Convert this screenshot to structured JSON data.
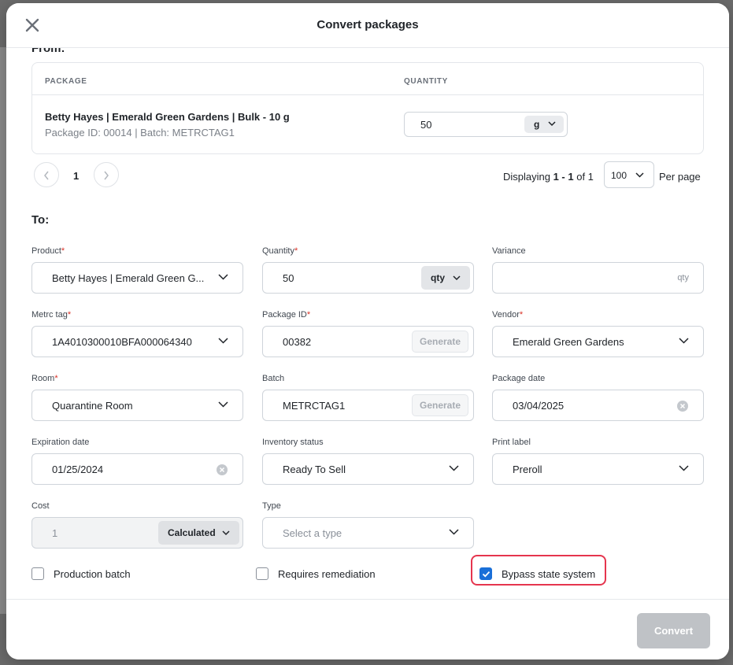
{
  "modal": {
    "title": "Convert packages",
    "close_icon": "close-icon"
  },
  "from": {
    "heading": "From:",
    "columns": [
      "PACKAGE",
      "QUANTITY"
    ],
    "rows": [
      {
        "name": "Betty Hayes | Emerald Green Gardens | Bulk - 10 g",
        "meta": "Package ID: 00014 | Batch: METRCTAG1",
        "quantity": "50",
        "unit": "g"
      }
    ],
    "pagination": {
      "current_page": "1",
      "displaying_prefix": "Displaying ",
      "displaying_range": "1 - 1",
      "displaying_suffix": " of 1",
      "per_page_value": "100",
      "per_page_label": "Per page"
    }
  },
  "to": {
    "heading": "To:",
    "fields": {
      "product": {
        "label": "Product",
        "value": "Betty Hayes | Emerald Green G..."
      },
      "quantity": {
        "label": "Quantity",
        "value": "50",
        "unit": "qty"
      },
      "variance": {
        "label": "Variance",
        "value": "",
        "suffix": "qty"
      },
      "metrc_tag": {
        "label": "Metrc tag",
        "value": "1A4010300010BFA000064340"
      },
      "package_id": {
        "label": "Package ID",
        "value": "00382",
        "button": "Generate"
      },
      "vendor": {
        "label": "Vendor",
        "value": "Emerald Green Gardens"
      },
      "room": {
        "label": "Room",
        "value": "Quarantine Room"
      },
      "batch": {
        "label": "Batch",
        "value": "METRCTAG1",
        "button": "Generate"
      },
      "package_date": {
        "label": "Package date",
        "value": "03/04/2025"
      },
      "expiration_date": {
        "label": "Expiration date",
        "value": "01/25/2024"
      },
      "inventory_status": {
        "label": "Inventory status",
        "value": "Ready To Sell"
      },
      "print_label": {
        "label": "Print label",
        "value": "Preroll"
      },
      "cost": {
        "label": "Cost",
        "value": "1",
        "mode": "Calculated"
      },
      "type": {
        "label": "Type",
        "placeholder": "Select a type"
      }
    },
    "checkboxes": [
      {
        "label": "Production batch",
        "checked": false
      },
      {
        "label": "Requires remediation",
        "checked": false
      },
      {
        "label": "Bypass state system",
        "checked": true
      }
    ]
  },
  "footer": {
    "convert_label": "Convert"
  },
  "colors": {
    "accent": "#1a6fd8",
    "highlight": "#e5354e",
    "required": "#d93025",
    "disabled_button": "#bfc2c6"
  }
}
